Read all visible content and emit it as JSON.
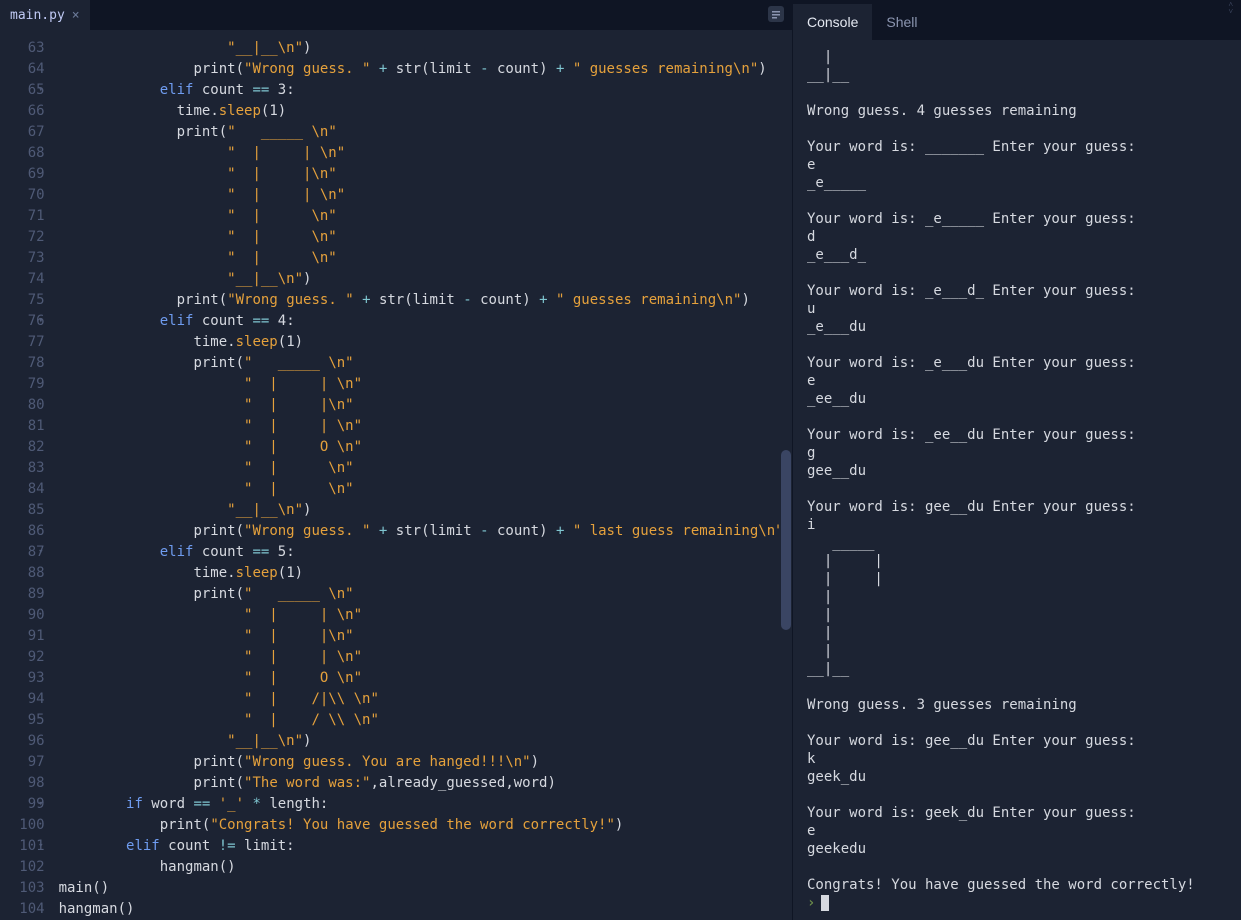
{
  "editor": {
    "tab_name": "main.py",
    "line_numbers": [
      63,
      64,
      65,
      66,
      67,
      68,
      69,
      70,
      71,
      72,
      73,
      74,
      75,
      76,
      77,
      78,
      79,
      80,
      81,
      82,
      83,
      84,
      85,
      86,
      87,
      88,
      89,
      90,
      91,
      92,
      93,
      94,
      95,
      96,
      97,
      98,
      99,
      100,
      101,
      102,
      103,
      104
    ],
    "fold_lines": [
      65,
      76,
      87,
      99,
      101
    ],
    "code_lines": [
      {
        "indent": 10,
        "tokens": [
          {
            "t": "str",
            "v": "\"__|__\\n\""
          },
          {
            "t": "id",
            "v": ")"
          }
        ]
      },
      {
        "indent": 8,
        "tokens": [
          {
            "t": "fn",
            "v": "print"
          },
          {
            "t": "id",
            "v": "("
          },
          {
            "t": "str",
            "v": "\"Wrong guess. \""
          },
          {
            "t": "id",
            "v": " "
          },
          {
            "t": "op",
            "v": "+"
          },
          {
            "t": "id",
            "v": " "
          },
          {
            "t": "fn",
            "v": "str"
          },
          {
            "t": "id",
            "v": "(limit "
          },
          {
            "t": "op",
            "v": "-"
          },
          {
            "t": "id",
            "v": " count) "
          },
          {
            "t": "op",
            "v": "+"
          },
          {
            "t": "id",
            "v": " "
          },
          {
            "t": "str",
            "v": "\" guesses remaining\\n\""
          },
          {
            "t": "id",
            "v": ")"
          }
        ]
      },
      {
        "indent": 6,
        "tokens": [
          {
            "t": "kw",
            "v": "elif"
          },
          {
            "t": "id",
            "v": " count "
          },
          {
            "t": "op",
            "v": "=="
          },
          {
            "t": "id",
            "v": " "
          },
          {
            "t": "num",
            "v": "3"
          },
          {
            "t": "id",
            "v": ":"
          }
        ]
      },
      {
        "indent": 7,
        "tokens": [
          {
            "t": "id",
            "v": "time"
          },
          {
            "t": "id",
            "v": "."
          },
          {
            "t": "meth",
            "v": "sleep"
          },
          {
            "t": "id",
            "v": "("
          },
          {
            "t": "num",
            "v": "1"
          },
          {
            "t": "id",
            "v": ")"
          }
        ]
      },
      {
        "indent": 7,
        "tokens": [
          {
            "t": "fn",
            "v": "print"
          },
          {
            "t": "id",
            "v": "("
          },
          {
            "t": "str",
            "v": "\"   _____ \\n\""
          }
        ]
      },
      {
        "indent": 10,
        "tokens": [
          {
            "t": "str",
            "v": "\"  |     | \\n\""
          }
        ]
      },
      {
        "indent": 10,
        "tokens": [
          {
            "t": "str",
            "v": "\"  |     |\\n\""
          }
        ]
      },
      {
        "indent": 10,
        "tokens": [
          {
            "t": "str",
            "v": "\"  |     | \\n\""
          }
        ]
      },
      {
        "indent": 10,
        "tokens": [
          {
            "t": "str",
            "v": "\"  |      \\n\""
          }
        ]
      },
      {
        "indent": 10,
        "tokens": [
          {
            "t": "str",
            "v": "\"  |      \\n\""
          }
        ]
      },
      {
        "indent": 10,
        "tokens": [
          {
            "t": "str",
            "v": "\"  |      \\n\""
          }
        ]
      },
      {
        "indent": 10,
        "tokens": [
          {
            "t": "str",
            "v": "\"__|__\\n\""
          },
          {
            "t": "id",
            "v": ")"
          }
        ]
      },
      {
        "indent": 7,
        "tokens": [
          {
            "t": "fn",
            "v": "print"
          },
          {
            "t": "id",
            "v": "("
          },
          {
            "t": "str",
            "v": "\"Wrong guess. \""
          },
          {
            "t": "id",
            "v": " "
          },
          {
            "t": "op",
            "v": "+"
          },
          {
            "t": "id",
            "v": " "
          },
          {
            "t": "fn",
            "v": "str"
          },
          {
            "t": "id",
            "v": "(limit "
          },
          {
            "t": "op",
            "v": "-"
          },
          {
            "t": "id",
            "v": " count) "
          },
          {
            "t": "op",
            "v": "+"
          },
          {
            "t": "id",
            "v": " "
          },
          {
            "t": "str",
            "v": "\" guesses remaining\\n\""
          },
          {
            "t": "id",
            "v": ")"
          }
        ]
      },
      {
        "indent": 6,
        "tokens": [
          {
            "t": "kw",
            "v": "elif"
          },
          {
            "t": "id",
            "v": " count "
          },
          {
            "t": "op",
            "v": "=="
          },
          {
            "t": "id",
            "v": " "
          },
          {
            "t": "num",
            "v": "4"
          },
          {
            "t": "id",
            "v": ":"
          }
        ]
      },
      {
        "indent": 8,
        "tokens": [
          {
            "t": "id",
            "v": "time"
          },
          {
            "t": "id",
            "v": "."
          },
          {
            "t": "meth",
            "v": "sleep"
          },
          {
            "t": "id",
            "v": "("
          },
          {
            "t": "num",
            "v": "1"
          },
          {
            "t": "id",
            "v": ")"
          }
        ]
      },
      {
        "indent": 8,
        "tokens": [
          {
            "t": "fn",
            "v": "print"
          },
          {
            "t": "id",
            "v": "("
          },
          {
            "t": "str",
            "v": "\"   _____ \\n\""
          }
        ]
      },
      {
        "indent": 11,
        "tokens": [
          {
            "t": "str",
            "v": "\"  |     | \\n\""
          }
        ]
      },
      {
        "indent": 11,
        "tokens": [
          {
            "t": "str",
            "v": "\"  |     |\\n\""
          }
        ]
      },
      {
        "indent": 11,
        "tokens": [
          {
            "t": "str",
            "v": "\"  |     | \\n\""
          }
        ]
      },
      {
        "indent": 11,
        "tokens": [
          {
            "t": "str",
            "v": "\"  |     O \\n\""
          }
        ]
      },
      {
        "indent": 11,
        "tokens": [
          {
            "t": "str",
            "v": "\"  |      \\n\""
          }
        ]
      },
      {
        "indent": 11,
        "tokens": [
          {
            "t": "str",
            "v": "\"  |      \\n\""
          }
        ]
      },
      {
        "indent": 10,
        "tokens": [
          {
            "t": "str",
            "v": "\"__|__\\n\""
          },
          {
            "t": "id",
            "v": ")"
          }
        ]
      },
      {
        "indent": 8,
        "tokens": [
          {
            "t": "fn",
            "v": "print"
          },
          {
            "t": "id",
            "v": "("
          },
          {
            "t": "str",
            "v": "\"Wrong guess. \""
          },
          {
            "t": "id",
            "v": " "
          },
          {
            "t": "op",
            "v": "+"
          },
          {
            "t": "id",
            "v": " "
          },
          {
            "t": "fn",
            "v": "str"
          },
          {
            "t": "id",
            "v": "(limit "
          },
          {
            "t": "op",
            "v": "-"
          },
          {
            "t": "id",
            "v": " count) "
          },
          {
            "t": "op",
            "v": "+"
          },
          {
            "t": "id",
            "v": " "
          },
          {
            "t": "str",
            "v": "\" last guess remaining\\n\""
          },
          {
            "t": "id",
            "v": ")"
          }
        ]
      },
      {
        "indent": 6,
        "tokens": [
          {
            "t": "kw",
            "v": "elif"
          },
          {
            "t": "id",
            "v": " count "
          },
          {
            "t": "op",
            "v": "=="
          },
          {
            "t": "id",
            "v": " "
          },
          {
            "t": "num",
            "v": "5"
          },
          {
            "t": "id",
            "v": ":"
          }
        ]
      },
      {
        "indent": 8,
        "tokens": [
          {
            "t": "id",
            "v": "time"
          },
          {
            "t": "id",
            "v": "."
          },
          {
            "t": "meth",
            "v": "sleep"
          },
          {
            "t": "id",
            "v": "("
          },
          {
            "t": "num",
            "v": "1"
          },
          {
            "t": "id",
            "v": ")"
          }
        ]
      },
      {
        "indent": 8,
        "tokens": [
          {
            "t": "fn",
            "v": "print"
          },
          {
            "t": "id",
            "v": "("
          },
          {
            "t": "str",
            "v": "\"   _____ \\n\""
          }
        ]
      },
      {
        "indent": 11,
        "tokens": [
          {
            "t": "str",
            "v": "\"  |     | \\n\""
          }
        ]
      },
      {
        "indent": 11,
        "tokens": [
          {
            "t": "str",
            "v": "\"  |     |\\n\""
          }
        ]
      },
      {
        "indent": 11,
        "tokens": [
          {
            "t": "str",
            "v": "\"  |     | \\n\""
          }
        ]
      },
      {
        "indent": 11,
        "tokens": [
          {
            "t": "str",
            "v": "\"  |     O \\n\""
          }
        ]
      },
      {
        "indent": 11,
        "tokens": [
          {
            "t": "str",
            "v": "\"  |    /|\\\\ \\n\""
          }
        ]
      },
      {
        "indent": 11,
        "tokens": [
          {
            "t": "str",
            "v": "\"  |    / \\\\ \\n\""
          }
        ]
      },
      {
        "indent": 10,
        "tokens": [
          {
            "t": "str",
            "v": "\"__|__\\n\""
          },
          {
            "t": "id",
            "v": ")"
          }
        ]
      },
      {
        "indent": 8,
        "tokens": [
          {
            "t": "fn",
            "v": "print"
          },
          {
            "t": "id",
            "v": "("
          },
          {
            "t": "str",
            "v": "\"Wrong guess. You are hanged!!!\\n\""
          },
          {
            "t": "id",
            "v": ")"
          }
        ]
      },
      {
        "indent": 8,
        "tokens": [
          {
            "t": "fn",
            "v": "print"
          },
          {
            "t": "id",
            "v": "("
          },
          {
            "t": "str",
            "v": "\"The word was:\""
          },
          {
            "t": "id",
            "v": ",already_guessed,word)"
          }
        ]
      },
      {
        "indent": 4,
        "tokens": [
          {
            "t": "kw",
            "v": "if"
          },
          {
            "t": "id",
            "v": " word "
          },
          {
            "t": "op",
            "v": "=="
          },
          {
            "t": "id",
            "v": " "
          },
          {
            "t": "str",
            "v": "'_'"
          },
          {
            "t": "id",
            "v": " "
          },
          {
            "t": "op",
            "v": "*"
          },
          {
            "t": "id",
            "v": " length:"
          }
        ]
      },
      {
        "indent": 6,
        "tokens": [
          {
            "t": "fn",
            "v": "print"
          },
          {
            "t": "id",
            "v": "("
          },
          {
            "t": "str",
            "v": "\"Congrats! You have guessed the word correctly!\""
          },
          {
            "t": "id",
            "v": ")"
          }
        ]
      },
      {
        "indent": 4,
        "tokens": [
          {
            "t": "kw",
            "v": "elif"
          },
          {
            "t": "id",
            "v": " count "
          },
          {
            "t": "op",
            "v": "!="
          },
          {
            "t": "id",
            "v": " limit:"
          }
        ]
      },
      {
        "indent": 6,
        "tokens": [
          {
            "t": "fn",
            "v": "hangman"
          },
          {
            "t": "id",
            "v": "()"
          }
        ]
      },
      {
        "indent": 0,
        "tokens": [
          {
            "t": "fn",
            "v": "main"
          },
          {
            "t": "id",
            "v": "()"
          }
        ]
      },
      {
        "indent": 0,
        "tokens": [
          {
            "t": "fn",
            "v": "hangman"
          },
          {
            "t": "id",
            "v": "()"
          }
        ]
      }
    ]
  },
  "right": {
    "tabs": [
      {
        "label": "Console",
        "active": true
      },
      {
        "label": "Shell",
        "active": false
      }
    ],
    "output_lines": [
      "  |      ",
      "__|__",
      "",
      "Wrong guess. 4 guesses remaining",
      "",
      "Your word is: _______ Enter your guess: ",
      "e",
      "_e_____",
      "",
      "Your word is: _e_____ Enter your guess: ",
      "d",
      "_e___d_",
      "",
      "Your word is: _e___d_ Enter your guess: ",
      "u",
      "_e___du",
      "",
      "Your word is: _e___du Enter your guess: ",
      "e",
      "_ee__du",
      "",
      "Your word is: _ee__du Enter your guess: ",
      "g",
      "gee__du",
      "",
      "Your word is: gee__du Enter your guess: ",
      "i",
      "   _____ ",
      "  |     | ",
      "  |     |",
      "  |      ",
      "  |      ",
      "  |      ",
      "  |      ",
      "__|__",
      "",
      "Wrong guess. 3 guesses remaining",
      "",
      "Your word is: gee__du Enter your guess: ",
      "k",
      "geek_du",
      "",
      "Your word is: geek_du Enter your guess: ",
      "e",
      "geekedu",
      "",
      "Congrats! You have guessed the word correctly!"
    ],
    "prompt": "›"
  }
}
